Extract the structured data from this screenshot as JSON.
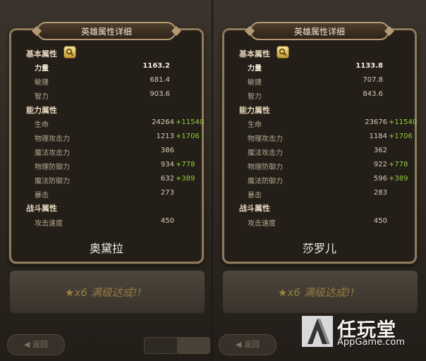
{
  "panel_title": "英雄属性详细",
  "sections": {
    "basic": "基本属性",
    "ability": "能力属性",
    "battle": "战斗属性"
  },
  "labels": {
    "strength": "力量",
    "agility": "敏捷",
    "intelligence": "智力",
    "hp": "生命",
    "phys_atk": "物理攻击力",
    "magic_atk": "魔法攻击力",
    "phys_def": "物理防御力",
    "magic_def": "魔法防御力",
    "crit": "暴击",
    "atk_speed": "攻击速度"
  },
  "heroes": [
    {
      "name": "奥黛拉",
      "strength": "1163.2",
      "agility": "681.4",
      "intelligence": "903.6",
      "hp": "24264",
      "hp_bonus": "+11540",
      "phys_atk": "1213",
      "phys_atk_bonus": "+1706",
      "magic_atk": "386",
      "phys_def": "934",
      "phys_def_bonus": "+778",
      "magic_def": "632",
      "magic_def_bonus": "+389",
      "crit": "273",
      "atk_speed": "450"
    },
    {
      "name": "莎罗儿",
      "strength": "1133.8",
      "agility": "707.8",
      "intelligence": "843.6",
      "hp": "23676",
      "hp_bonus": "+11540",
      "phys_atk": "1184",
      "phys_atk_bonus": "+1706",
      "magic_atk": "362",
      "phys_def": "922",
      "phys_def_bonus": "+778",
      "magic_def": "596",
      "magic_def_bonus": "+389",
      "crit": "283",
      "atk_speed": "450"
    }
  ],
  "background": {
    "banner": "满级达成!!",
    "banner_count": "x6",
    "back_label": "返回"
  },
  "watermark": {
    "title": "任玩堂",
    "url": "AppGame.com"
  },
  "colors": {
    "bonus_green": "#8fcf3c",
    "panel_border": "#8e7a5d"
  }
}
